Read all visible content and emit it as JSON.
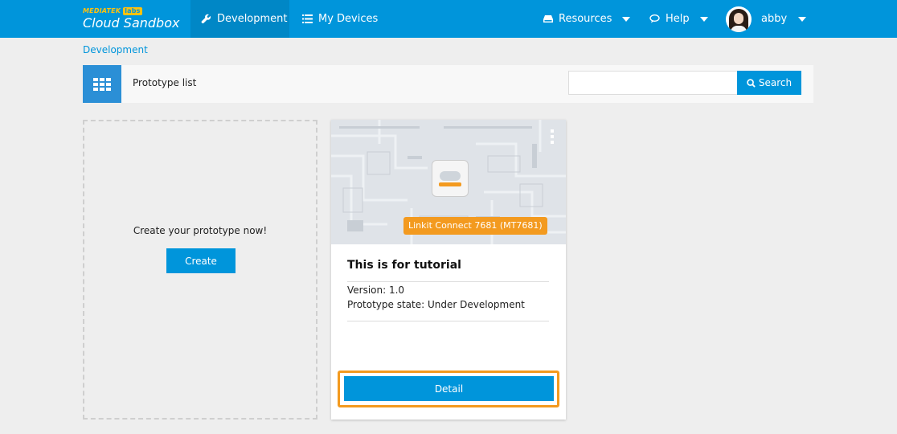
{
  "brand": {
    "company": "MEDIATEK",
    "labs": "labs",
    "product": "Cloud Sandbox"
  },
  "nav": {
    "development": "Development",
    "my_devices": "My Devices",
    "resources": "Resources",
    "help": "Help",
    "user": "abby"
  },
  "breadcrumb": "Development",
  "list_header": {
    "title": "Prototype list",
    "search_value": "",
    "search_button": "Search"
  },
  "create_card": {
    "prompt": "Create your prototype now!",
    "button": "Create"
  },
  "prototype": {
    "chip_label": "Linkit Connect 7681 (MT7681)",
    "title": "This is for tutorial",
    "version": "Version: 1.0",
    "state": "Prototype state: Under Development",
    "detail_button": "Detail"
  },
  "colors": {
    "primary": "#0095db",
    "nav_active": "#0087c6",
    "accent": "#f39a1f",
    "background": "#eeeeee"
  },
  "icons": [
    "wrench-icon",
    "list-icon",
    "drive-icon",
    "chat-icon",
    "grid-icon",
    "search-icon"
  ]
}
